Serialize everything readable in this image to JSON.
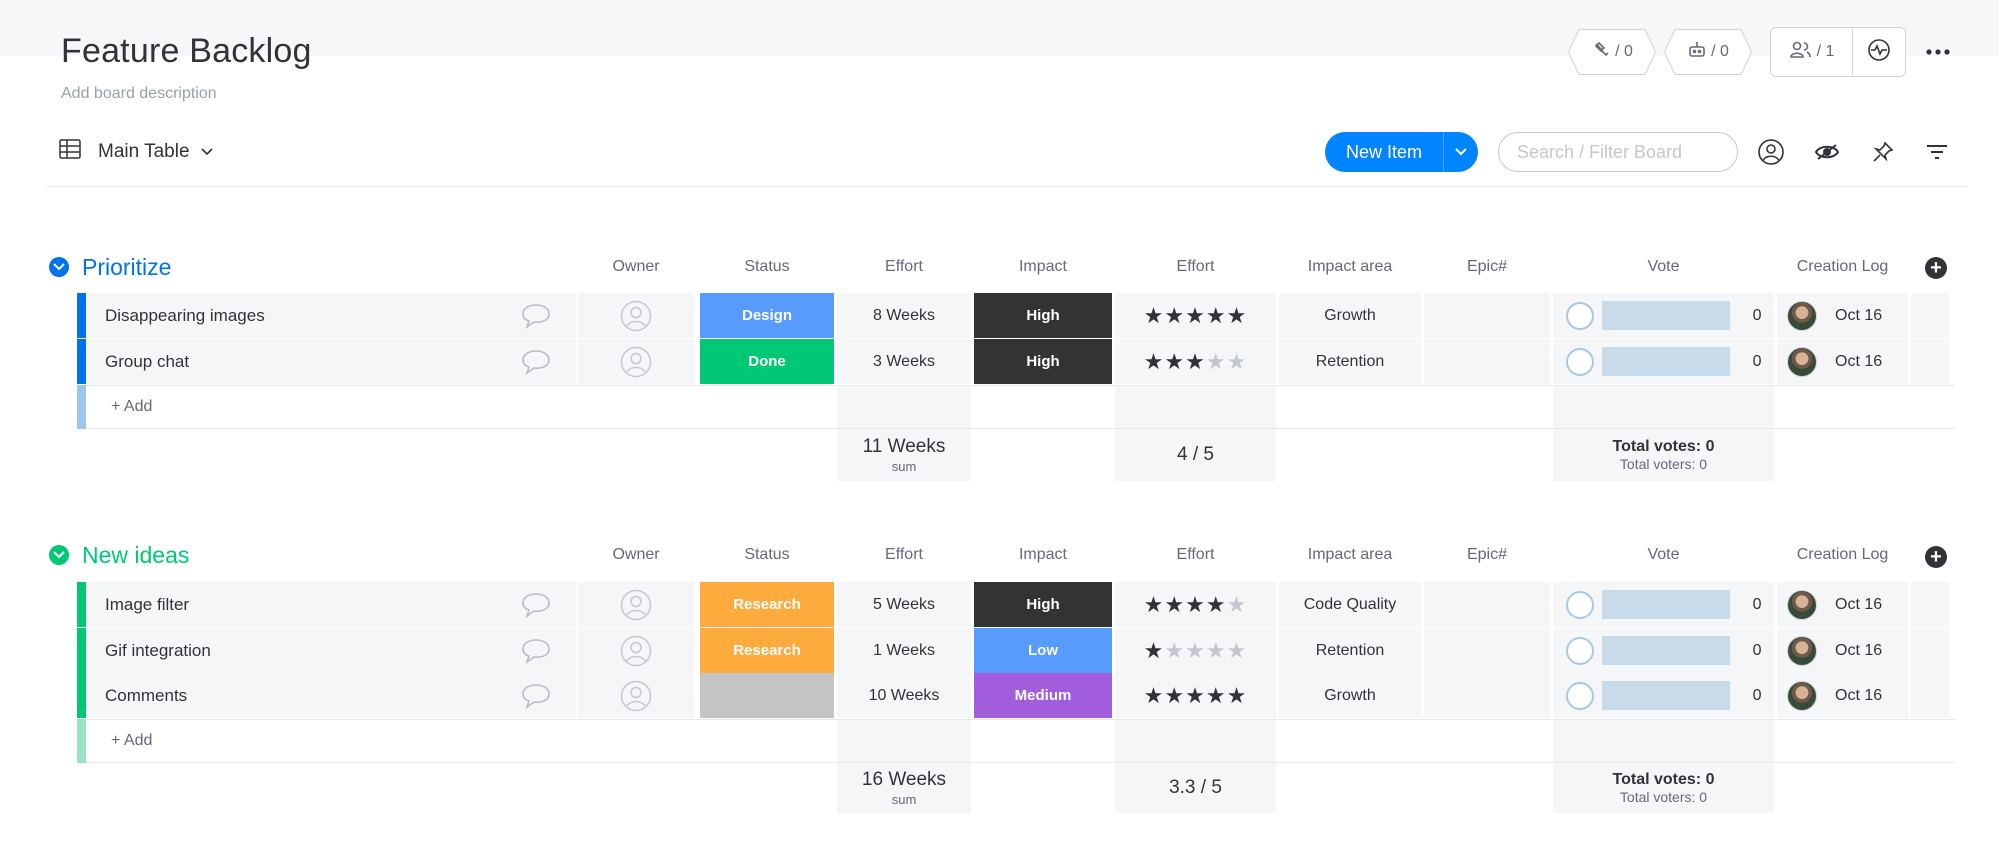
{
  "board": {
    "title": "Feature Backlog",
    "description": "Add board description",
    "integrations_count": "/ 0",
    "automations_count": "/ 0",
    "members_count": "/ 1"
  },
  "toolbar": {
    "view_label": "Main Table",
    "new_item_label": "New Item",
    "search_placeholder": "Search / Filter Board"
  },
  "columns": {
    "owner": "Owner",
    "status": "Status",
    "effort": "Effort",
    "impact": "Impact",
    "effort2": "Effort",
    "impact_area": "Impact area",
    "epic": "Epic#",
    "vote": "Vote",
    "creation_log": "Creation Log"
  },
  "colors": {
    "prioritize": "#0073ea",
    "new_ideas": "#00c875",
    "status_design": "#579bfc",
    "status_done": "#00c875",
    "status_research": "#fdab3d",
    "impact_high": "#333333",
    "impact_low": "#579bfc",
    "impact_medium": "#a25ddc"
  },
  "groups": [
    {
      "title": "Prioritize",
      "add_label": "+ Add",
      "rows": [
        {
          "name": "Disappearing images",
          "status": "Design",
          "effort": "8 Weeks",
          "impact": "High",
          "stars": 5,
          "impact_area": "Growth",
          "epic": "",
          "votes": "0",
          "date": "Oct 16"
        },
        {
          "name": "Group chat",
          "status": "Done",
          "effort": "3 Weeks",
          "impact": "High",
          "stars": 3,
          "impact_area": "Retention",
          "epic": "",
          "votes": "0",
          "date": "Oct 16"
        }
      ],
      "summary": {
        "effort": "11 Weeks",
        "effort_label": "sum",
        "rating": "4 / 5",
        "total_votes": "Total votes: 0",
        "total_voters": "Total voters: 0"
      }
    },
    {
      "title": "New ideas",
      "add_label": "+ Add",
      "rows": [
        {
          "name": "Image filter",
          "status": "Research",
          "effort": "5 Weeks",
          "impact": "High",
          "stars": 4,
          "impact_area": "Code Quality",
          "epic": "",
          "votes": "0",
          "date": "Oct 16"
        },
        {
          "name": "Gif integration",
          "status": "Research",
          "effort": "1 Weeks",
          "impact": "Low",
          "stars": 1,
          "impact_area": "Retention",
          "epic": "",
          "votes": "0",
          "date": "Oct 16"
        },
        {
          "name": "Comments",
          "status": "",
          "effort": "10 Weeks",
          "impact": "Medium",
          "stars": 5,
          "impact_area": "Growth",
          "epic": "",
          "votes": "0",
          "date": "Oct 16"
        }
      ],
      "summary": {
        "effort": "16 Weeks",
        "effort_label": "sum",
        "rating": "3.3 / 5",
        "total_votes": "Total votes: 0",
        "total_voters": "Total voters: 0"
      }
    }
  ]
}
